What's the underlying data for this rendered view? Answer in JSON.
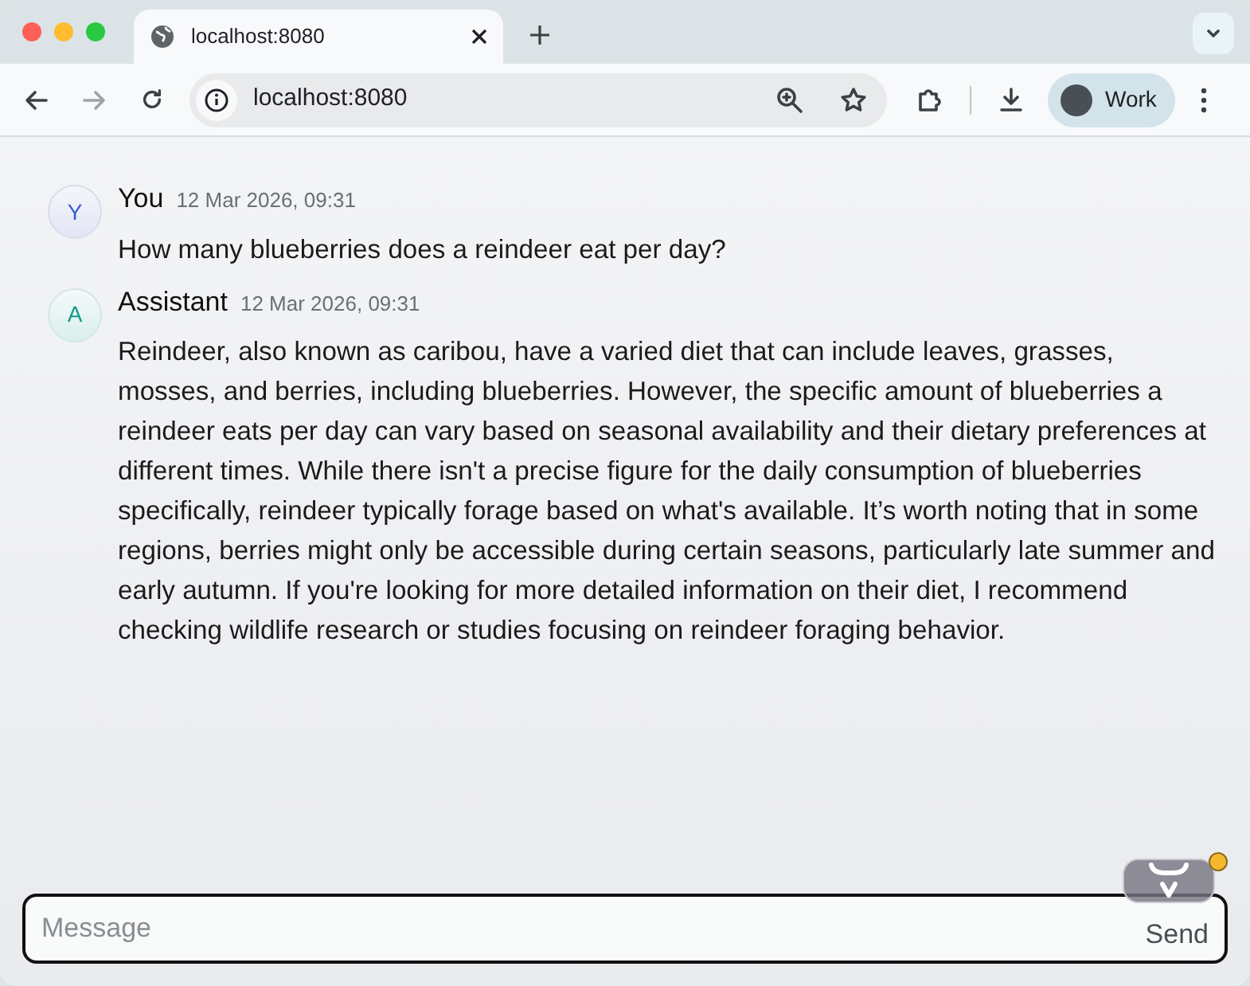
{
  "browser": {
    "tab": {
      "title": "localhost:8080",
      "selected": true
    },
    "address": "localhost:8080",
    "profile": "Work"
  },
  "messages": [
    {
      "kind": "user",
      "avatar": "Y",
      "author": "You",
      "time": "12 Mar 2026, 09:31",
      "text": "How many blueberries does a reindeer eat per day?"
    },
    {
      "kind": "assistant",
      "avatar": "A",
      "author": "Assistant",
      "time": "12 Mar 2026, 09:31",
      "text": "Reindeer, also known as caribou, have a varied diet that can include leaves, grasses, mosses, and berries, including blueberries. However, the specific amount of blueberries a reindeer eats per day can vary based on seasonal availability and their dietary preferences at different times. While there isn't a precise figure for the daily consumption of blueberries specifically, reindeer typically forage based on what's available. It’s worth noting that in some regions, berries might only be accessible during certain seasons, particularly late summer and early autumn. If you're looking for more detailed information on their diet, I recommend checking wildlife research or studies focusing on reindeer foraging behavior."
    }
  ],
  "composer": {
    "placeholder": "Message",
    "send": "Send"
  }
}
